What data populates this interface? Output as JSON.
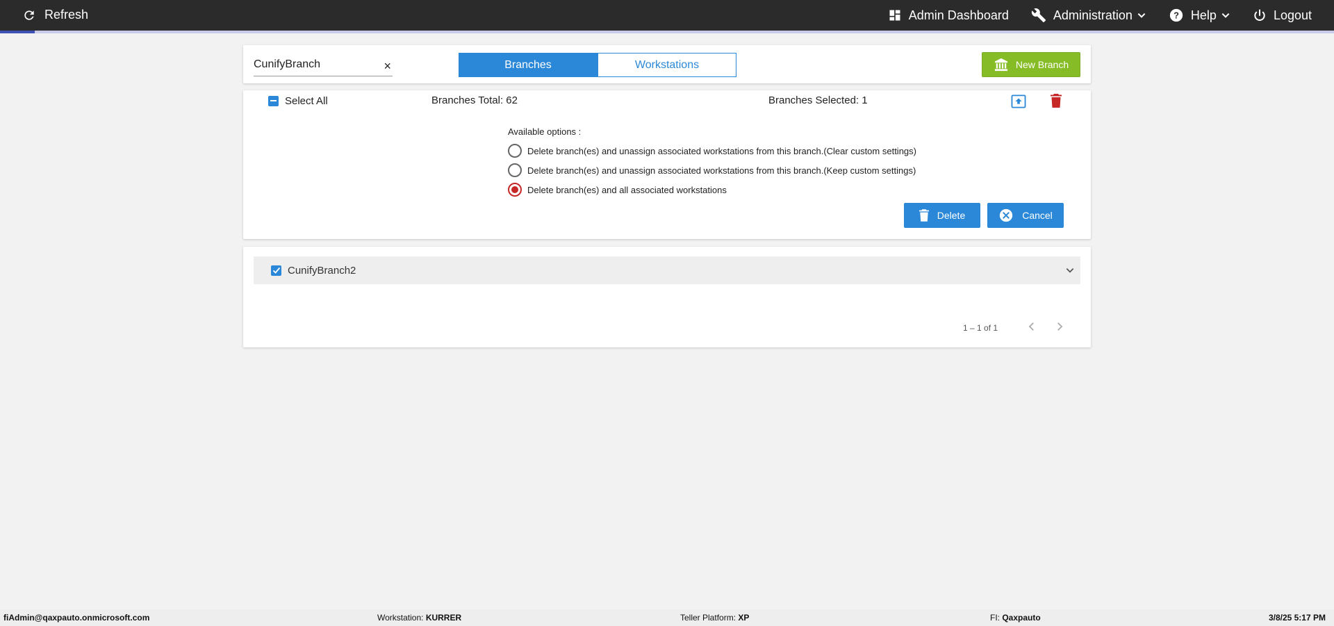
{
  "nav": {
    "refresh_label": "Refresh",
    "admin_dashboard_label": "Admin Dashboard",
    "administration_label": "Administration",
    "help_label": "Help",
    "logout_label": "Logout",
    "load_progress": 0.026
  },
  "toolbar": {
    "search_value": "CunifyBranch",
    "clear_glyph": "×",
    "tabs": [
      {
        "label": "Branches",
        "active": true
      },
      {
        "label": "Workstations",
        "active": false
      }
    ],
    "new_branch_label": "New Branch"
  },
  "actions": {
    "select_all_label": "Select All",
    "branches_total": "Branches Total: 62",
    "branches_selected": "Branches Selected: 1",
    "options_title": "Available options :",
    "options": [
      {
        "label": "Delete branch(es) and unassign associated workstations from this branch.(Clear custom settings)",
        "selected": false
      },
      {
        "label": "Delete branch(es) and unassign associated workstations from this branch.(Keep custom settings)",
        "selected": false
      },
      {
        "label": "Delete branch(es) and all associated workstations",
        "selected": true
      }
    ],
    "delete_label": "Delete",
    "cancel_label": "Cancel"
  },
  "list": {
    "rows": [
      {
        "label": "CunifyBranch2",
        "checked": true
      }
    ],
    "pager_text": "1 – 1 of 1"
  },
  "footer": {
    "user": "fiAdmin@qaxpauto.onmicrosoft.com",
    "workstation_label": "Workstation: ",
    "workstation_value": "KURRER",
    "platform_label": "Teller Platform: ",
    "platform_value": "XP",
    "fi_label": "FI: ",
    "fi_value": "Qaxpauto",
    "datetime": "3/8/25 5:17 PM"
  },
  "colors": {
    "accent": "#2b88d8",
    "new_branch": "#86bc25",
    "danger": "#c62828",
    "topbar": "#2b2b2b"
  }
}
